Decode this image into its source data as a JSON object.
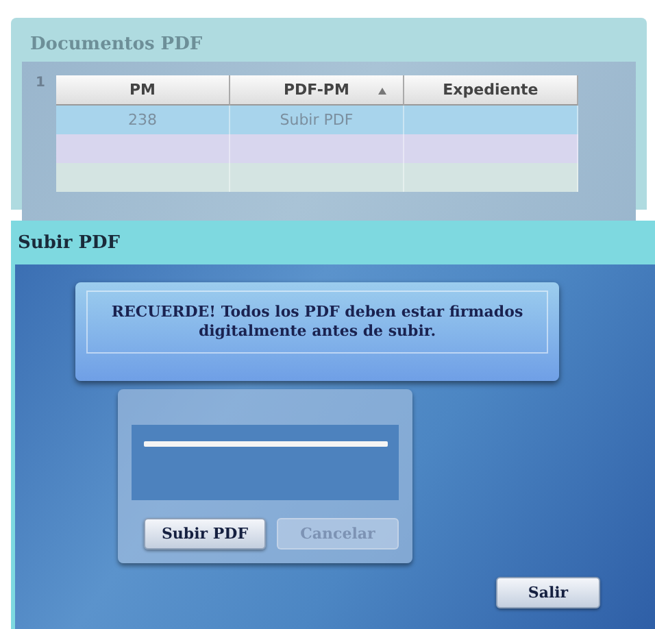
{
  "panel": {
    "title": "Documentos PDF",
    "page_number": "1"
  },
  "table": {
    "columns": [
      {
        "label": "PM",
        "sorted": false
      },
      {
        "label": "PDF-PM",
        "sorted": true
      },
      {
        "label": "Expediente",
        "sorted": false
      }
    ],
    "rows": [
      {
        "selected": true,
        "cells": [
          "238",
          "Subir PDF"
        ]
      },
      {
        "selected": false
      },
      {
        "selected": false
      }
    ]
  },
  "dialog": {
    "title": "Subir PDF",
    "notice": "RECUERDE!  Todos los PDF deben estar firmados digitalmente antes de subir.",
    "upload_button": {
      "label": "Subir PDF",
      "disabled": false
    },
    "cancel_button": {
      "label": "Cancelar",
      "disabled": true
    },
    "exit_button": {
      "label": "Salir",
      "disabled": false
    }
  }
}
